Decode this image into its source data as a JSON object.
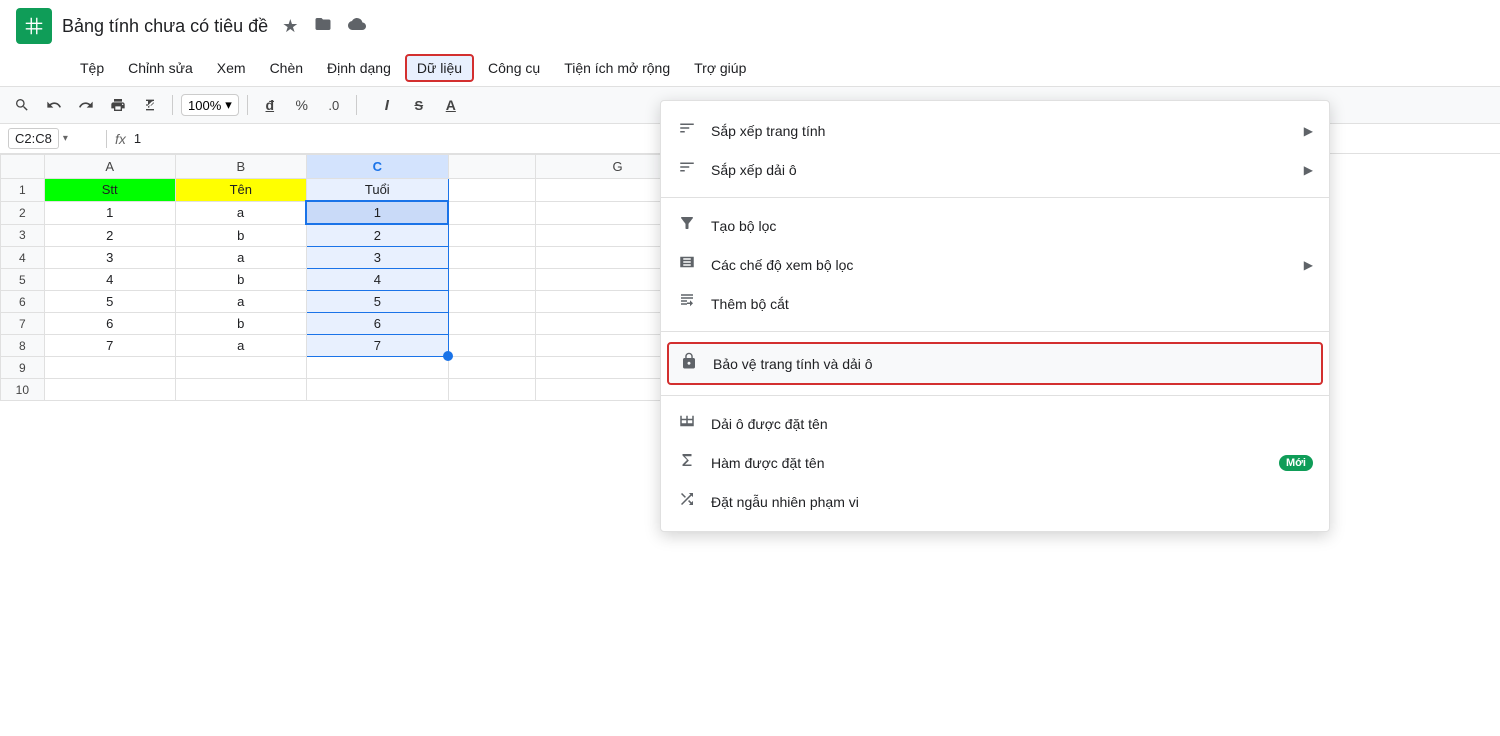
{
  "app": {
    "icon_color": "#0F9D58",
    "title": "Bảng tính chưa có tiêu đề",
    "star_icon": "★",
    "folder_icon": "📁",
    "cloud_icon": "☁"
  },
  "menubar": {
    "items": [
      {
        "id": "tep",
        "label": "Tệp"
      },
      {
        "id": "chinh-sua",
        "label": "Chỉnh sửa"
      },
      {
        "id": "xem",
        "label": "Xem"
      },
      {
        "id": "chen",
        "label": "Chèn"
      },
      {
        "id": "dinh-dang",
        "label": "Định dạng"
      },
      {
        "id": "du-lieu",
        "label": "Dữ liệu",
        "active": true
      },
      {
        "id": "cong-cu",
        "label": "Công cụ"
      },
      {
        "id": "tien-ich-mo-rong",
        "label": "Tiện ích mở rộng"
      },
      {
        "id": "tro-giup",
        "label": "Trợ giúp"
      }
    ]
  },
  "toolbar": {
    "zoom": "100%",
    "format_d": "đ",
    "format_percent": "%",
    "format_decimal": ".0",
    "italic_label": "I",
    "strikethrough_label": "S̶",
    "underline_label": "A"
  },
  "formula_bar": {
    "cell_ref": "C2:C8",
    "fx_label": "fx",
    "value": "1"
  },
  "spreadsheet": {
    "col_headers": [
      "",
      "A",
      "B",
      "C",
      "",
      "G"
    ],
    "rows": [
      {
        "row_num": "",
        "cells": [
          "",
          "A",
          "B",
          "C",
          "",
          "G"
        ]
      },
      {
        "row_num": "1",
        "cells": [
          "Stt",
          "Tên",
          "Tuổi"
        ]
      },
      {
        "row_num": "2",
        "cells": [
          "1",
          "a",
          "1"
        ]
      },
      {
        "row_num": "3",
        "cells": [
          "2",
          "b",
          "2"
        ]
      },
      {
        "row_num": "4",
        "cells": [
          "3",
          "a",
          "3"
        ]
      },
      {
        "row_num": "5",
        "cells": [
          "4",
          "b",
          "4"
        ]
      },
      {
        "row_num": "6",
        "cells": [
          "5",
          "a",
          "5"
        ]
      },
      {
        "row_num": "7",
        "cells": [
          "6",
          "b",
          "6"
        ]
      },
      {
        "row_num": "8",
        "cells": [
          "7",
          "a",
          "7"
        ]
      },
      {
        "row_num": "9",
        "cells": [
          "",
          "",
          ""
        ]
      },
      {
        "row_num": "10",
        "cells": [
          "",
          "",
          ""
        ]
      }
    ]
  },
  "dropdown": {
    "sections": [
      {
        "items": [
          {
            "id": "sap-xep-trang-tinh",
            "icon": "sort",
            "label": "Sắp xếp trang tính",
            "has_arrow": true
          },
          {
            "id": "sap-xep-dai-o",
            "icon": "sort",
            "label": "Sắp xếp dải ô",
            "has_arrow": true
          }
        ]
      },
      {
        "items": [
          {
            "id": "tao-bo-loc",
            "icon": "filter",
            "label": "Tạo bộ lọc",
            "has_arrow": false
          },
          {
            "id": "cac-che-do-xem-bo-loc",
            "icon": "grid",
            "label": "Các chế độ xem bộ lọc",
            "has_arrow": true
          },
          {
            "id": "them-bo-cat",
            "icon": "slice",
            "label": "Thêm bộ cắt",
            "has_arrow": false
          }
        ]
      },
      {
        "items": [
          {
            "id": "bao-ve-trang-tinh",
            "icon": "lock",
            "label": "Bảo vệ trang tính và dải ô",
            "has_arrow": false,
            "highlighted": true
          }
        ]
      },
      {
        "items": [
          {
            "id": "dai-o-duoc-dat-ten",
            "icon": "named-range",
            "label": "Dải ô được đặt tên",
            "has_arrow": false
          },
          {
            "id": "ham-duoc-dat-ten",
            "icon": "sigma",
            "label": "Hàm được đặt tên",
            "has_arrow": false,
            "badge": "Mới"
          },
          {
            "id": "dat-ngau-nhien",
            "icon": "random",
            "label": "Đặt ngẫu nhiên phạm vi",
            "has_arrow": false
          }
        ]
      }
    ]
  }
}
